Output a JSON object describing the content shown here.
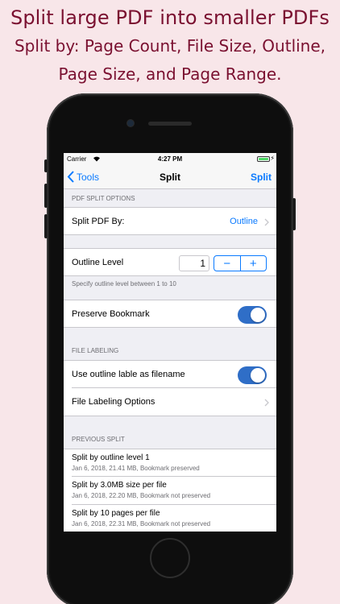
{
  "promo": {
    "line1": "Split large PDF into smaller PDFs",
    "line2": "Split by: Page Count, File Size, Outline,",
    "line3": "Page Size, and Page Range."
  },
  "status": {
    "carrier": "Carrier",
    "time": "4:27 PM"
  },
  "nav": {
    "back_label": "Tools",
    "title": "Split",
    "action_label": "Split"
  },
  "options": {
    "header": "PDF SPLIT OPTIONS",
    "split_by_label": "Split PDF By:",
    "split_by_value": "Outline",
    "outline_level_label": "Outline Level",
    "outline_level_value": "1",
    "stepper_minus": "−",
    "stepper_plus": "+",
    "outline_level_note": "Specify outline level between 1 to 10",
    "preserve_bookmark_label": "Preserve Bookmark",
    "preserve_bookmark_on": true
  },
  "labeling": {
    "header": "FILE LABELING",
    "use_outline_label": "Use outline lable as filename",
    "use_outline_on": true,
    "options_label": "File Labeling Options"
  },
  "history": {
    "header": "PREVIOUS SPLIT",
    "items": [
      {
        "title": "Split by outline level 1",
        "subtitle": "Jan 6, 2018, 21.41 MB, Bookmark preserved"
      },
      {
        "title": "Split by 3.0MB size per file",
        "subtitle": "Jan 6, 2018, 22.20 MB, Bookmark not preserved"
      },
      {
        "title": "Split by 10 pages per file",
        "subtitle": "Jan 6, 2018, 22.31 MB, Bookmark not preserved"
      }
    ]
  },
  "colors": {
    "accent": "#0a7aff",
    "toggle_on": "#2f6ec7",
    "promo_text": "#7a1030",
    "background": "#f8e6e9"
  }
}
